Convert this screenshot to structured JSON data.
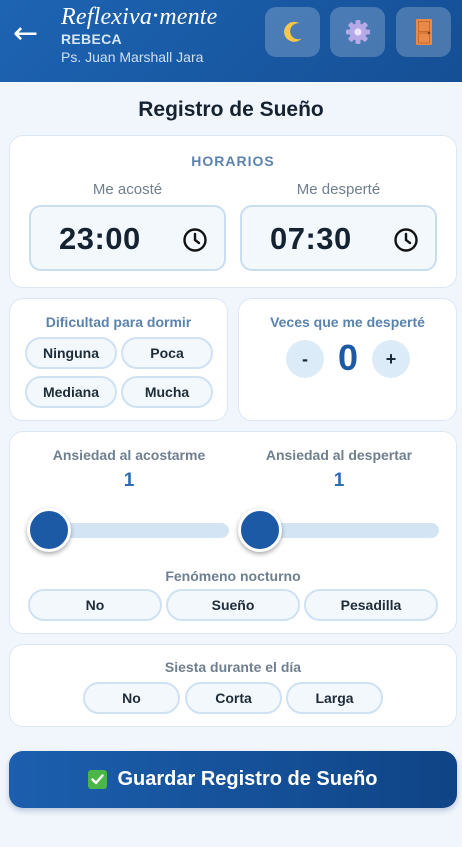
{
  "header": {
    "back_icon": "arrow-left-icon",
    "brand_left": "Reflexiva",
    "brand_dot": "•",
    "brand_right": "mente",
    "patient_name": "REBECA",
    "therapist": "Ps. Juan Marshall Jara",
    "buttons": [
      "moon-icon",
      "gear-icon",
      "door-icon"
    ]
  },
  "page_title": "Registro de Sueño",
  "horarios": {
    "label": "HORARIOS",
    "bed": {
      "label": "Me acosté",
      "time": "23:00"
    },
    "wake": {
      "label": "Me desperté",
      "time": "07:30"
    }
  },
  "dificultad": {
    "label": "Dificultad para dormir",
    "options": [
      "Ninguna",
      "Poca",
      "Mediana",
      "Mucha"
    ]
  },
  "despertares": {
    "label": "Veces que me desperté",
    "minus": "-",
    "value": "0",
    "plus": "+"
  },
  "ansiedad": {
    "bed": {
      "label": "Ansiedad al acostarme",
      "value": "1",
      "level": 0
    },
    "wake": {
      "label": "Ansiedad al despertar",
      "value": "1",
      "level": 0
    }
  },
  "fenomeno": {
    "label": "Fenómeno nocturno",
    "options": [
      "No",
      "Sueño",
      "Pesadilla"
    ]
  },
  "siesta": {
    "label": "Siesta durante el día",
    "options": [
      "No",
      "Corta",
      "Larga"
    ]
  },
  "save_button": {
    "check_icon": "check-box-icon",
    "label": "Guardar Registro de Sueño"
  },
  "colors": {
    "header": "#1d64b3",
    "accent": "#1c5aa6",
    "chip_border": "#cfe1f2",
    "save": "#0f4486"
  }
}
